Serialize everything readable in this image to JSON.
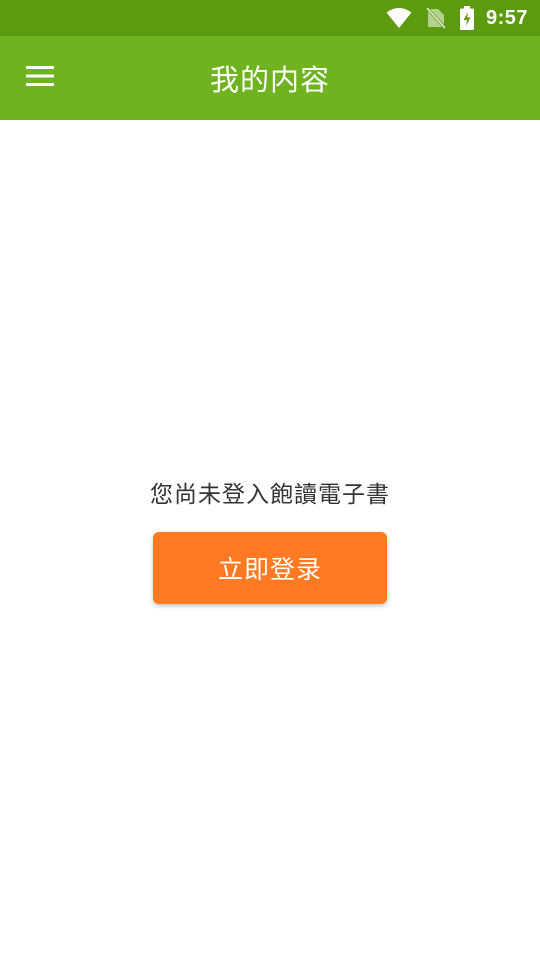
{
  "status_bar": {
    "time": "9:57",
    "icons": [
      "wifi-icon",
      "no-sim-icon",
      "battery-charging-icon"
    ],
    "color": "#5c9a0f"
  },
  "app_bar": {
    "title": "我的内容",
    "menu_icon": "hamburger-menu-icon",
    "color": "#6fb321"
  },
  "main": {
    "login_prompt": "您尚未登入飽讀電子書",
    "login_button_label": "立即登录",
    "login_button_color": "#ff7a22"
  }
}
